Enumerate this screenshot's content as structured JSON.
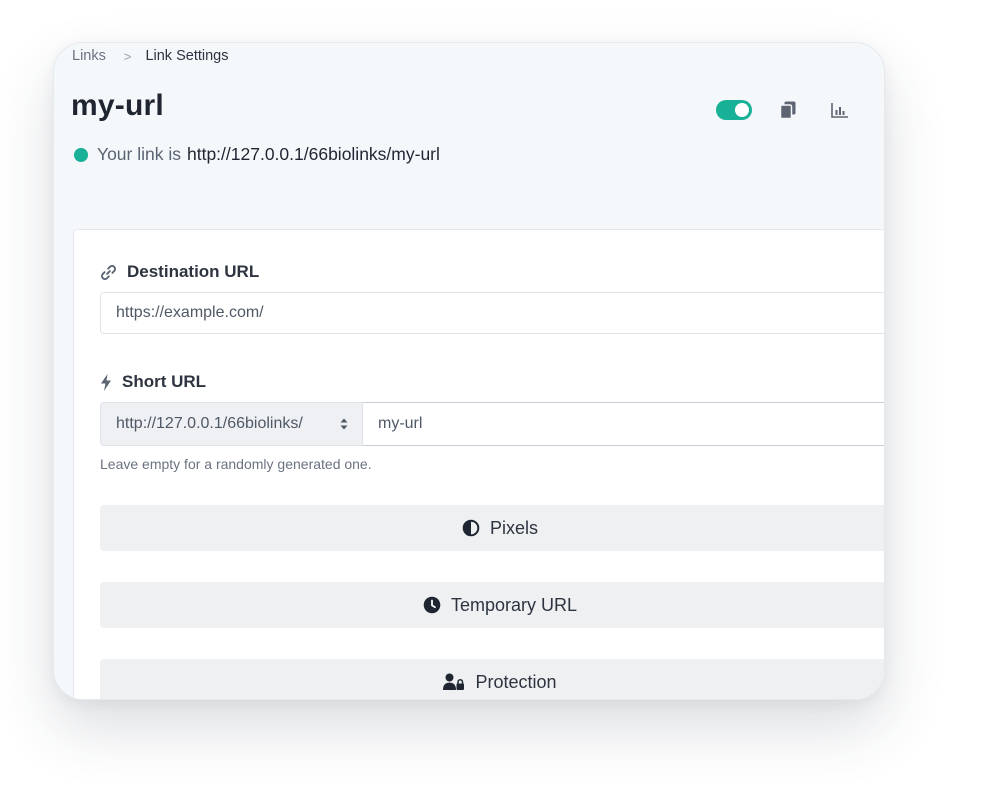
{
  "breadcrumb": {
    "parent": "Links",
    "separator": ">",
    "current": "Link Settings"
  },
  "page": {
    "title": "my-url"
  },
  "header_actions": {
    "toggle_enabled": true,
    "icons": [
      "copy-icon",
      "bar-chart-icon"
    ]
  },
  "link_status": {
    "label": "Your link is",
    "url": "http://127.0.0.1/66biolinks/my-url"
  },
  "form": {
    "destination": {
      "label": "Destination URL",
      "icon": "link-icon",
      "value": "https://example.com/"
    },
    "short_url": {
      "label": "Short URL",
      "icon": "bolt-icon",
      "prefix": "http://127.0.0.1/66biolinks/",
      "value": "my-url",
      "help": "Leave empty for a randomly generated one."
    },
    "sections": [
      {
        "label": "Pixels",
        "icon": "adjust-icon"
      },
      {
        "label": "Temporary URL",
        "icon": "clock-icon"
      },
      {
        "label": "Protection",
        "icon": "user-lock-icon"
      }
    ]
  },
  "colors": {
    "accent": "#18b097",
    "page_bg": "#f5f8fb",
    "section_bg": "#eef0f2",
    "text": "#2d3440"
  }
}
